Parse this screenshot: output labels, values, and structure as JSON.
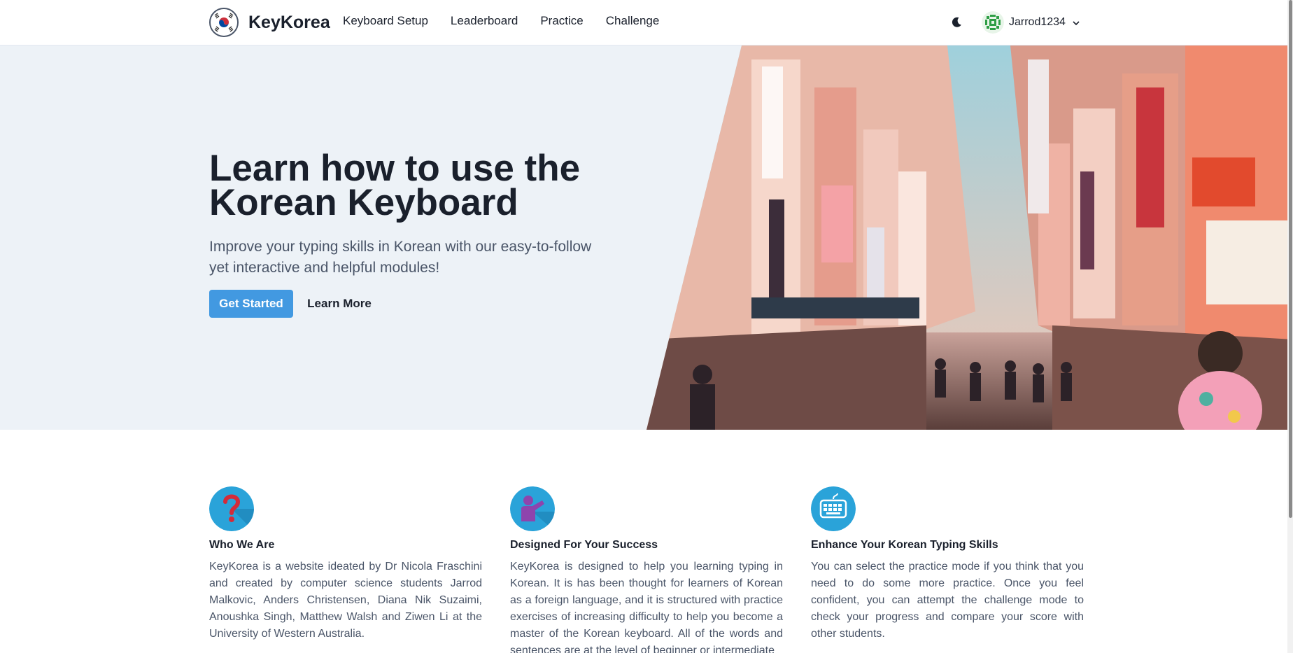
{
  "brand": {
    "name": "KeyKorea",
    "logo_icon": "korean-flag-icon"
  },
  "nav": {
    "links": [
      {
        "label": "Keyboard Setup"
      },
      {
        "label": "Leaderboard"
      },
      {
        "label": "Practice"
      },
      {
        "label": "Challenge"
      }
    ],
    "theme_icon": "moon-icon",
    "user": {
      "name": "Jarrod1234",
      "avatar_icon": "identicon-avatar",
      "menu_icon": "chevron-down-icon"
    }
  },
  "hero": {
    "title": "Learn how to use the Korean Keyboard",
    "subtitle": "Improve your typing skills in Korean with our easy-to-follow yet interactive and helpful modules!",
    "primary_button": "Get Started",
    "secondary_button": "Learn More",
    "image_icon": "seoul-street-photo"
  },
  "features": [
    {
      "icon": "question-mark-icon",
      "title": "Who We Are",
      "text": "KeyKorea is a website ideated by Dr Nicola Fraschini and created by computer science students Jarrod Malkovic, Anders Christensen, Diana Nik Suzaimi, Anoushka Singh, Matthew Walsh and Ziwen Li at the University of Western Australia."
    },
    {
      "icon": "presenter-icon",
      "title": "Designed For Your Success",
      "text": "KeyKorea is designed to help you learning typing in Korean. It is has been thought for learners of Korean as a foreign language, and it is structured with practice exercises of increasing difficulty to help you become a master of the Korean keyboard. All of the words and sentences are at the level of beginner or intermediate"
    },
    {
      "icon": "keyboard-icon",
      "title": "Enhance Your Korean Typing Skills",
      "text": "You can select the practice mode if you think that you need to do some more practice. Once you feel confident, you can attempt the challenge mode to check your progress and compare your score with other students."
    }
  ],
  "colors": {
    "accent": "#4299e1",
    "hero_bg": "#edf2f7",
    "text_dark": "#1a202c",
    "text_muted": "#4a5568"
  }
}
